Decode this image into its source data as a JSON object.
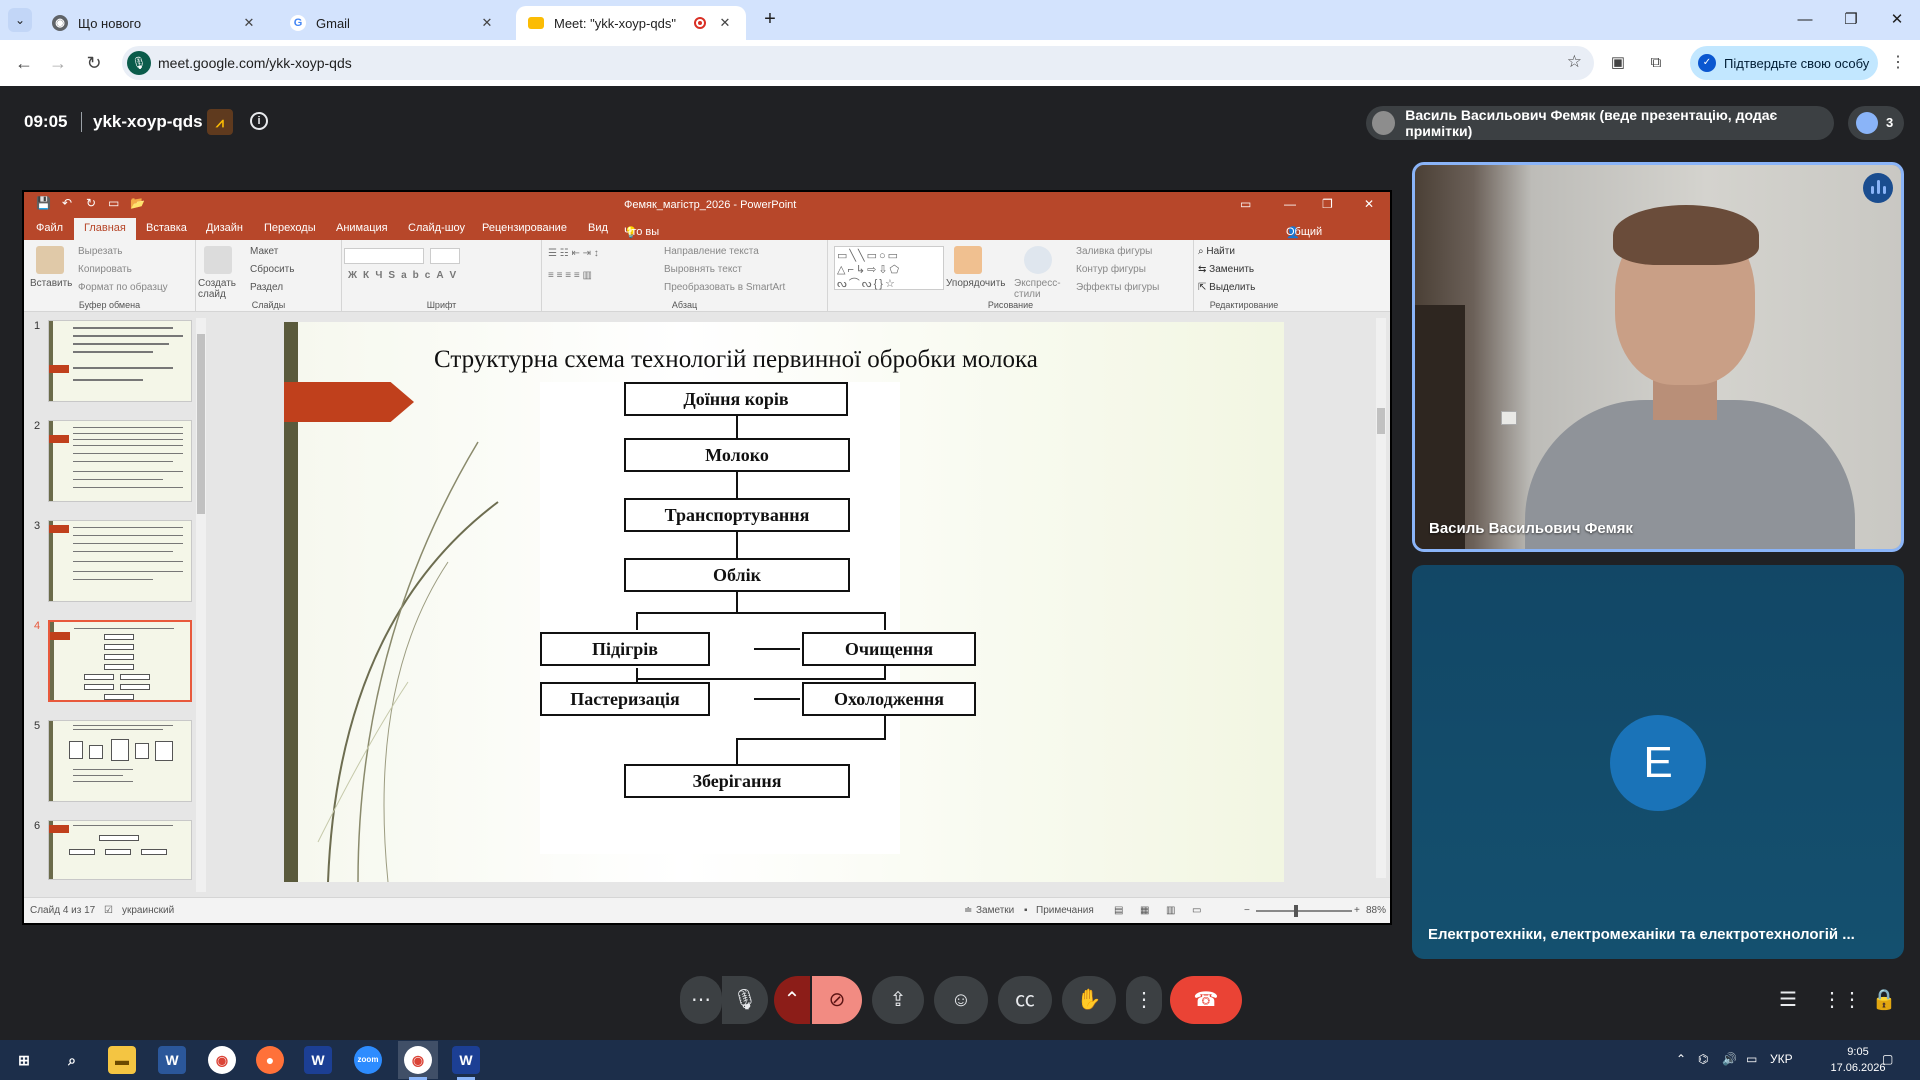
{
  "browser": {
    "tabs": [
      {
        "title": "Що нового"
      },
      {
        "title": "Gmail"
      },
      {
        "title": "Meet: \"ykk-xoyp-qds\""
      }
    ],
    "url": "meet.google.com/ykk-xoyp-qds",
    "verify_label": "Підтвердьте свою особу"
  },
  "meeting": {
    "time": "09:05",
    "code": "ykk-xoyp-qds",
    "presenter_status": "Василь Васильович Фемяк (веде презентацію, додає примітки)",
    "participant_count": "3"
  },
  "powerpoint": {
    "window_title": "Фемяк_магістр_2026 - PowerPoint",
    "menu": [
      "Файл",
      "Главная",
      "Вставка",
      "Дизайн",
      "Переходы",
      "Анимация",
      "Слайд-шоу",
      "Рецензирование",
      "Вид"
    ],
    "tell_me": "Что вы хотите сделать?",
    "share_label": "Общий доступ",
    "ribbon": {
      "clipboard": {
        "paste": "Вставить",
        "cut": "Вырезать",
        "copy": "Копировать",
        "format": "Формат по образцу",
        "group": "Буфер обмена"
      },
      "slides": {
        "new": "Создать слайд",
        "layout": "Макет",
        "reset": "Сбросить",
        "section": "Раздел",
        "group": "Слайды"
      },
      "font": {
        "group": "Шрифт"
      },
      "paragraph": {
        "direction": "Направление текста",
        "align": "Выровнять текст",
        "smartart": "Преобразовать в SmartArt",
        "group": "Абзац"
      },
      "drawing": {
        "arrange": "Упорядочить",
        "styles": "Экспресс-стили",
        "fill": "Заливка фигуры",
        "outline": "Контур фигуры",
        "effects": "Эффекты фигуры",
        "group": "Рисование"
      },
      "editing": {
        "find": "Найти",
        "replace": "Заменить",
        "select": "Выделить",
        "group": "Редактирование"
      }
    },
    "thumbnails": [
      "1",
      "2",
      "3",
      "4",
      "5",
      "6"
    ],
    "selected_slide": 4,
    "slide": {
      "title": "Структурна схема технологій  первинної обробки молока",
      "steps": [
        "Доїння корів",
        "Молоко",
        "Транспортування",
        "Облік",
        "Підігрів",
        "Очищення",
        "Пастеризація",
        "Охолодження",
        "Зберігання"
      ]
    },
    "status": {
      "slide_info": "Слайд 4 из 17",
      "language": "украинский",
      "notes": "Заметки",
      "comments": "Примечания",
      "zoom": "88%"
    }
  },
  "participants": [
    {
      "name": "Василь Васильович Фемяк"
    },
    {
      "name": "Електротехніки, електромеханіки та електротехнологій ...",
      "initial": "E"
    }
  ],
  "taskbar": {
    "lang": "УКР",
    "time": "9:05",
    "date": "17.06.2026"
  },
  "colors": {
    "meet_bg": "#202124",
    "ppt_accent": "#b7472a",
    "end_call": "#ea4335",
    "active_speaker": "#8ab4f8"
  }
}
